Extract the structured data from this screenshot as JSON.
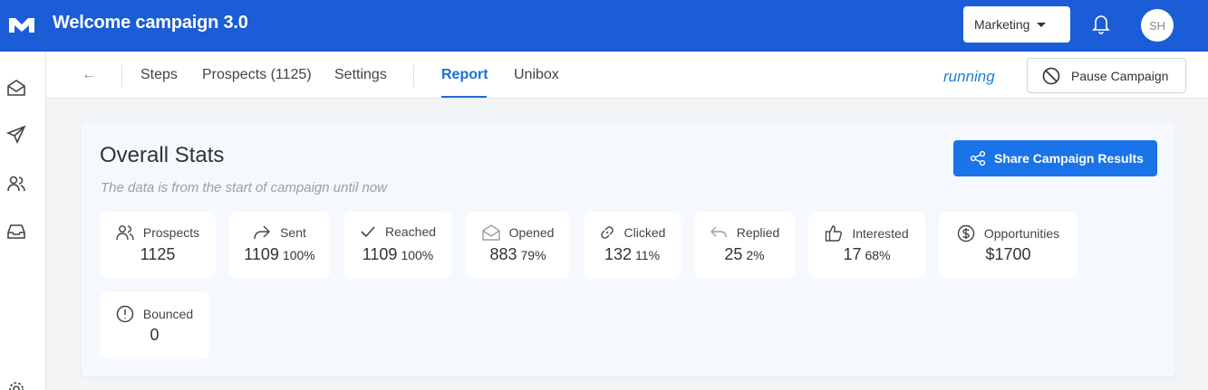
{
  "header": {
    "title": "Welcome campaign 3.0",
    "workspace": "Marketing",
    "avatar_initials": "SH",
    "brand_color": "#1a5dd6"
  },
  "sidebar": {
    "icons": [
      "mail-open-icon",
      "send-icon",
      "users-icon",
      "inbox-icon",
      "settings-icon"
    ]
  },
  "subnav": {
    "back": "←",
    "tabs": [
      "Steps",
      "Prospects (1125)",
      "Settings",
      "Report",
      "Unibox"
    ],
    "active_tab": "Report",
    "status": "running",
    "pause_label": "Pause Campaign"
  },
  "stats": {
    "title": "Overall Stats",
    "subtitle": "The data is from the start of campaign until now",
    "share_label": "Share Campaign Results",
    "items": [
      {
        "label": "Prospects",
        "value": "1125",
        "pct": "",
        "icon": "users-icon"
      },
      {
        "label": "Sent",
        "value": "1109",
        "pct": "100%",
        "icon": "share-arrow-icon"
      },
      {
        "label": "Reached",
        "value": "1109",
        "pct": "100%",
        "icon": "check-icon"
      },
      {
        "label": "Opened",
        "value": "883",
        "pct": "79%",
        "icon": "mail-open-icon"
      },
      {
        "label": "Clicked",
        "value": "132",
        "pct": "11%",
        "icon": "link-icon"
      },
      {
        "label": "Replied",
        "value": "25",
        "pct": "2%",
        "icon": "reply-icon"
      },
      {
        "label": "Interested",
        "value": "17",
        "pct": "68%",
        "icon": "thumbs-up-icon"
      },
      {
        "label": "Opportunities",
        "value": "$1700",
        "pct": "",
        "icon": "dollar-icon"
      },
      {
        "label": "Bounced",
        "value": "0",
        "pct": "",
        "icon": "alert-circle-icon"
      }
    ]
  }
}
